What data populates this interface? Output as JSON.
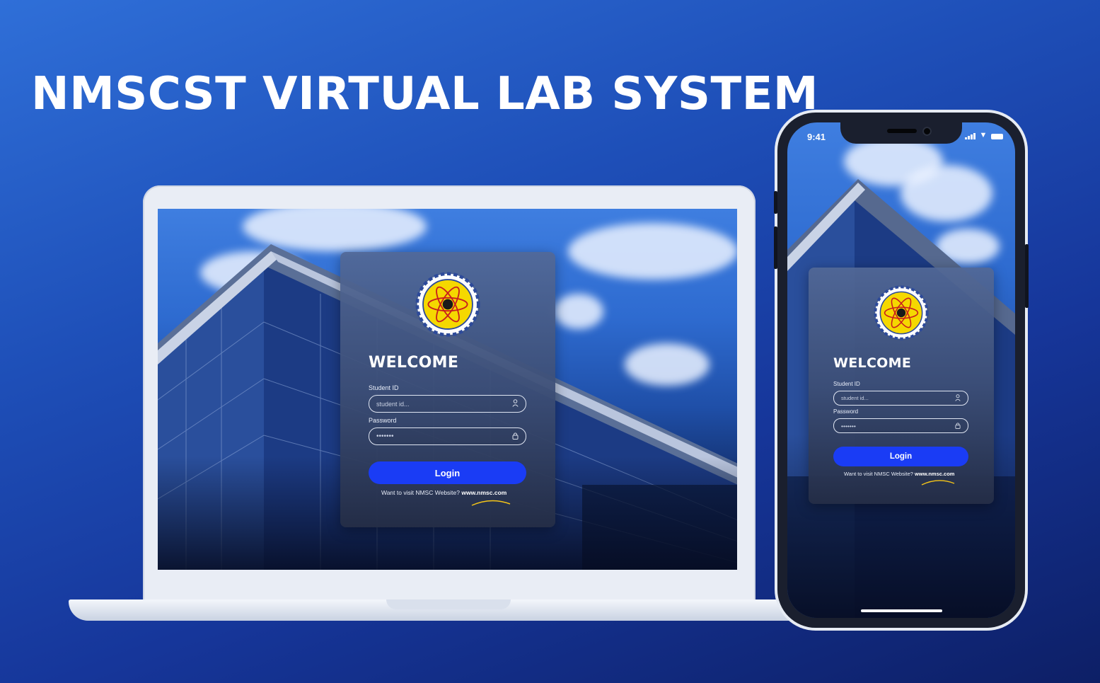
{
  "headline": "NMSCST VIRTUAL LAB SYSTEM",
  "colors": {
    "accent_button": "#1a3cf5",
    "background": "#1e4fb8",
    "logo_yellow": "#f5d800"
  },
  "login": {
    "welcome": "WELCOME",
    "student_id_label": "Student ID",
    "student_id_placeholder": "student id...",
    "password_label": "Password",
    "password_value": "•••••••",
    "login_button": "Login",
    "visit_text": "Want to visit  NMSC  Website?",
    "visit_link": "www.nmsc.com",
    "user_icon": "user-icon",
    "lock_icon": "lock-icon"
  },
  "phone_status": {
    "time": "9:41"
  }
}
